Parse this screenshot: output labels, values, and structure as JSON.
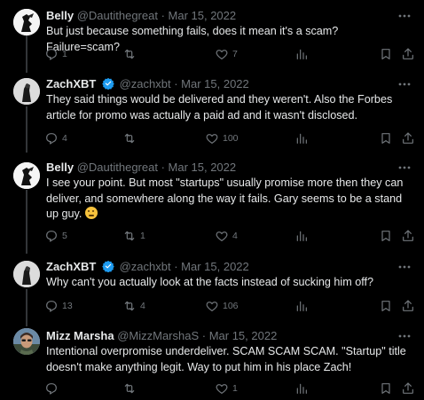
{
  "tweets": [
    {
      "name": "Belly",
      "handle": "@Dautithegreat",
      "date": "· Mar 15, 2022",
      "text": "But just because something fails, does it mean it's a scam? Failure=scam?",
      "replies": "1",
      "retweets": "",
      "likes": "7",
      "views": ""
    },
    {
      "name": "ZachXBT",
      "handle": "@zachxbt",
      "date": "· Mar 15, 2022",
      "text": "They said things would be delivered and they weren't. Also the Forbes article for promo was actually a paid ad and it wasn't disclosed.",
      "replies": "4",
      "retweets": "",
      "likes": "100",
      "views": ""
    },
    {
      "name": "Belly",
      "handle": "@Dautithegreat",
      "date": "· Mar 15, 2022",
      "text": "I see your point. But most \"startups\" usually promise more then they can deliver, and somewhere along the way it fails. Gary seems to be a stand up guy.",
      "replies": "5",
      "retweets": "1",
      "likes": "4",
      "views": ""
    },
    {
      "name": "ZachXBT",
      "handle": "@zachxbt",
      "date": "· Mar 15, 2022",
      "text": "Why can't you actually look at the facts instead of sucking him off?",
      "replies": "13",
      "retweets": "4",
      "likes": "106",
      "views": ""
    },
    {
      "name": "Mizz Marsha",
      "handle": "@MizzMarshaS",
      "date": "· Mar 15, 2022",
      "text": "Intentional overpromise underdeliver. SCAM SCAM SCAM. \"Startup\" title doesn't make anything legit. Way to put him in his place Zach!",
      "replies": "",
      "retweets": "",
      "likes": "1",
      "views": ""
    }
  ],
  "icons": {
    "reply": "reply-icon",
    "retweet": "retweet-icon",
    "like": "heart-icon",
    "views": "views-icon",
    "bookmark": "bookmark-icon",
    "share": "share-icon",
    "verified": "verified-badge-icon",
    "more": "more-icon"
  },
  "colors": {
    "background": "#000000",
    "text": "#e7e9ea",
    "muted": "#71767b",
    "verified": "#1d9bf0"
  }
}
